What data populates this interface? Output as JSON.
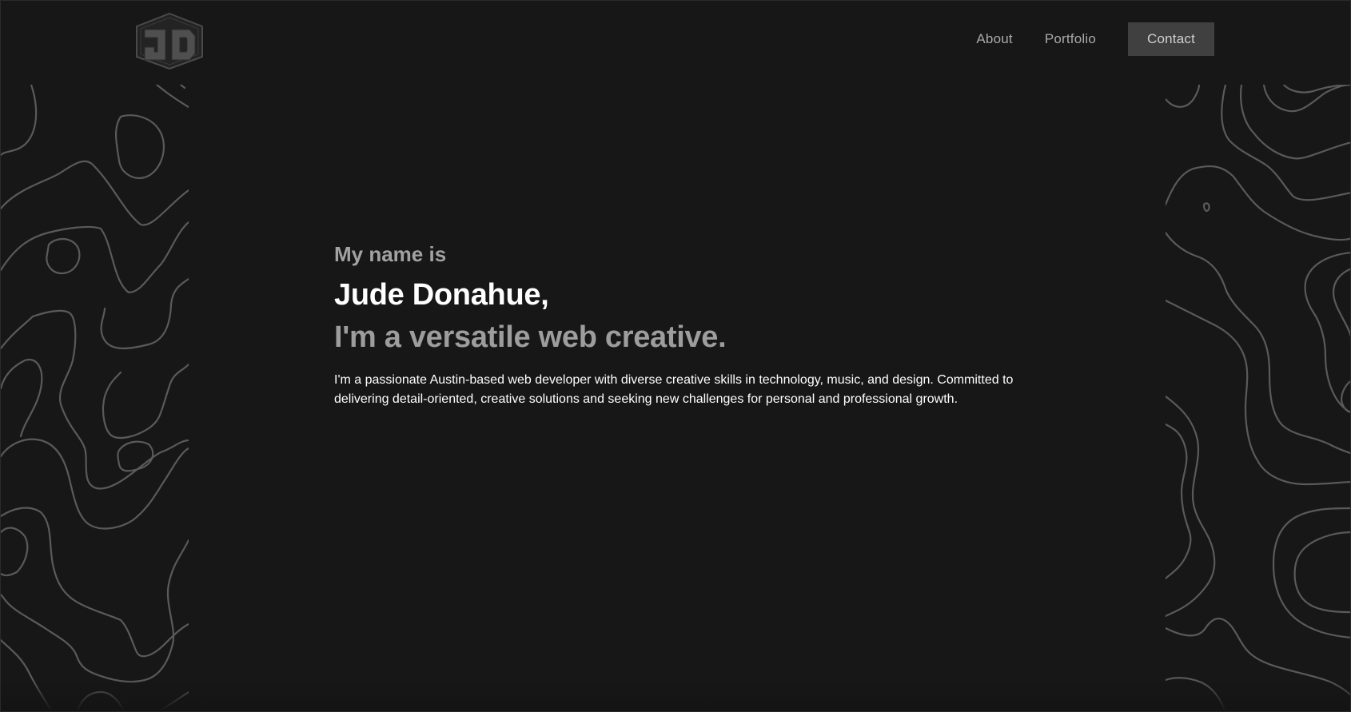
{
  "header": {
    "logo_icon": "jd-hexagon-logo",
    "nav": {
      "about": "About",
      "portfolio": "Portfolio",
      "contact": "Contact"
    }
  },
  "hero": {
    "intro": "My name is",
    "name": "Jude Donahue,",
    "tagline": "I'm a versatile web creative.",
    "bio": "I'm a passionate Austin-based web developer with diverse creative skills in technology, music, and design. Committed to delivering detail-oriented, creative solutions and seeking new challenges for personal and professional growth."
  },
  "colors": {
    "background": "#171717",
    "topo_line": "#5a5a5a",
    "contact_button_bg": "#404040",
    "nav_text": "#a9a9a9",
    "heading_white": "#ffffff",
    "heading_gray": "#9d9d9d"
  }
}
